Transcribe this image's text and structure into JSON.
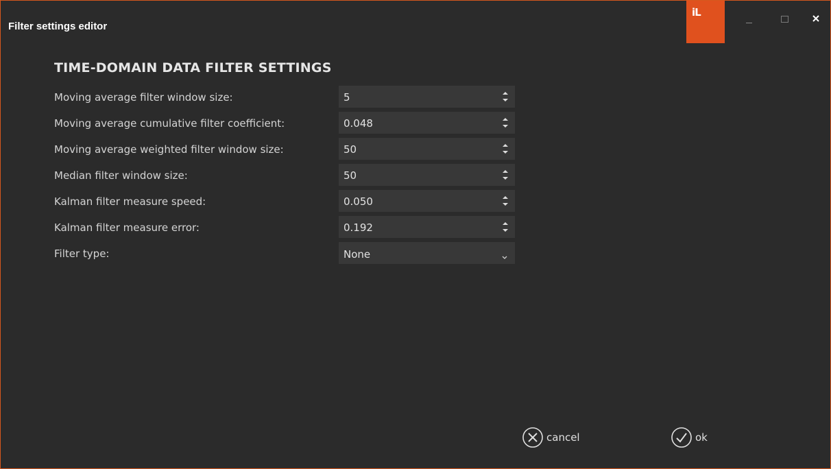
{
  "window": {
    "title": "Filter settings editor",
    "logo_text": "iL",
    "accent_color": "#e0511e"
  },
  "section": {
    "heading": "TIME-DOMAIN DATA FILTER SETTINGS"
  },
  "fields": [
    {
      "label": "Moving average filter window size:",
      "value": "5",
      "control": "spinbox"
    },
    {
      "label": "Moving average cumulative filter coefficient:",
      "value": "0.048",
      "control": "spinbox"
    },
    {
      "label": "Moving average weighted filter window size:",
      "value": "50",
      "control": "spinbox"
    },
    {
      "label": "Median filter window size:",
      "value": "50",
      "control": "spinbox"
    },
    {
      "label": "Kalman filter measure speed:",
      "value": "0.050",
      "control": "spinbox"
    },
    {
      "label": "Kalman filter measure error:",
      "value": "0.192",
      "control": "spinbox"
    },
    {
      "label": "Filter type:",
      "value": "None",
      "control": "dropdown"
    }
  ],
  "buttons": {
    "cancel_label": "cancel",
    "ok_label": "ok"
  }
}
